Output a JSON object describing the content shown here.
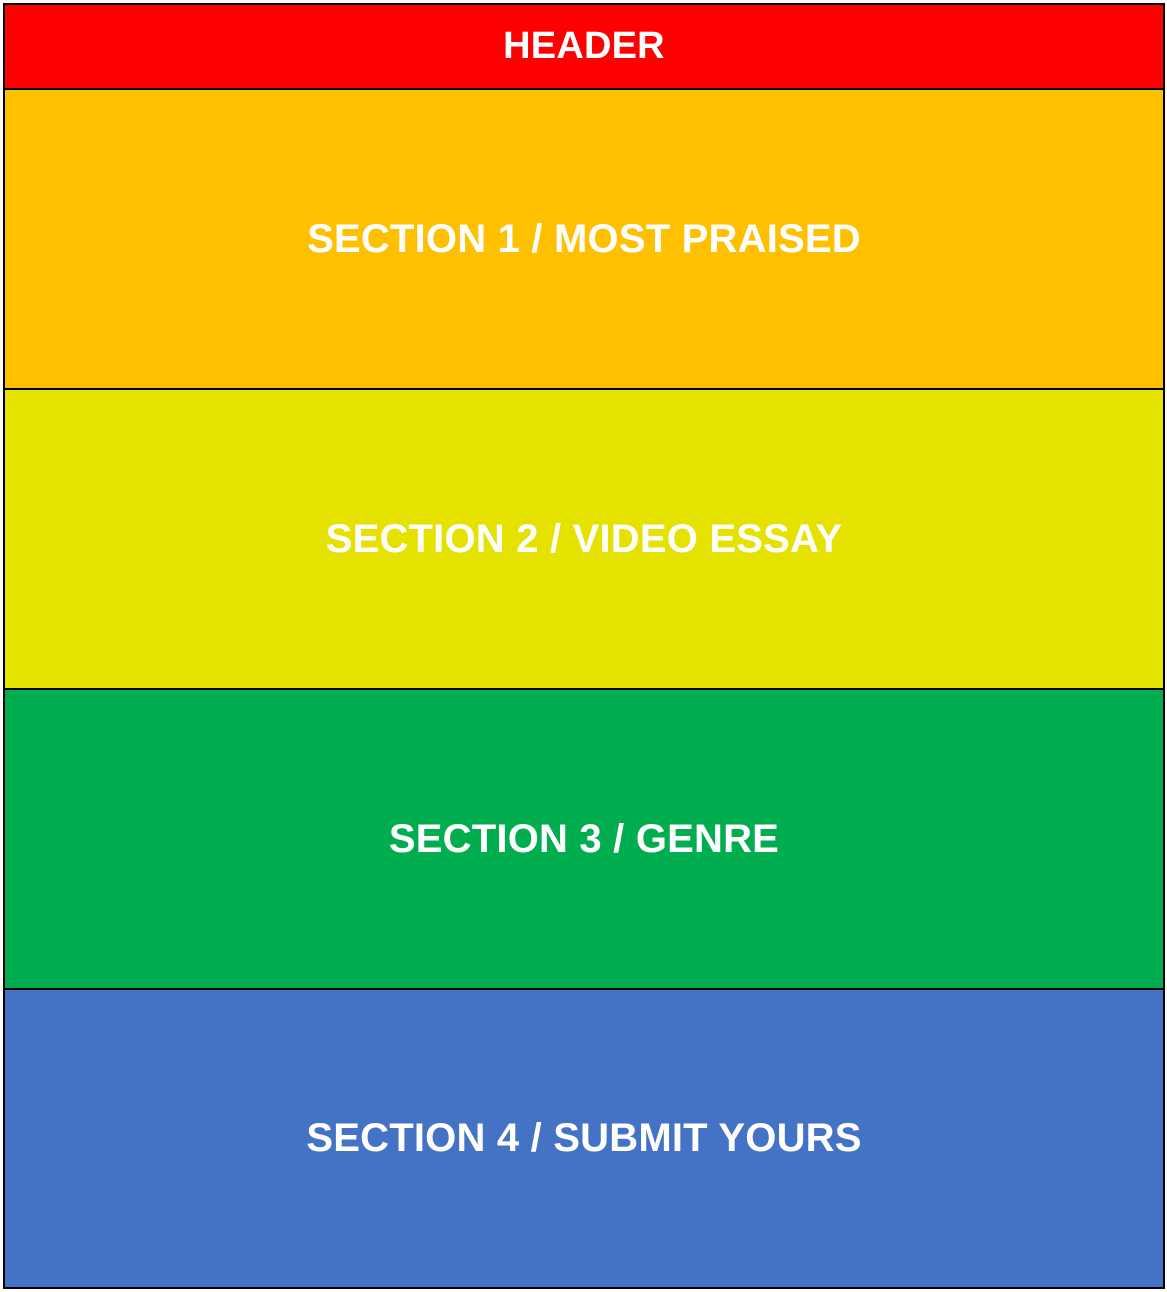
{
  "layout": {
    "header": {
      "label": "HEADER",
      "color": "#FF0000"
    },
    "sections": [
      {
        "label": "SECTION 1 / MOST PRAISED",
        "color": "#FFC000"
      },
      {
        "label": "SECTION 2 / VIDEO ESSAY",
        "color": "#E6E200"
      },
      {
        "label": "SECTION 3 / GENRE",
        "color": "#00AE50"
      },
      {
        "label": "SECTION 4 / SUBMIT YOURS",
        "color": "#4472C4"
      }
    ]
  }
}
